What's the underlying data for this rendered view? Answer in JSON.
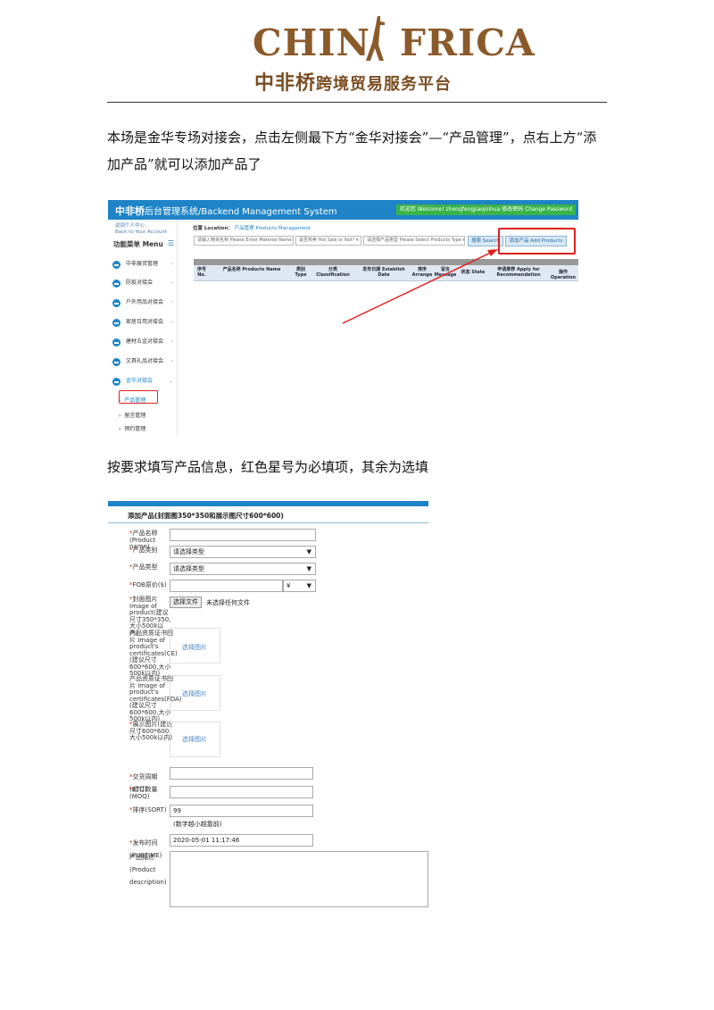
{
  "logo": {
    "main_text": "CHINAFRICA",
    "sub_brand": "中非桥",
    "sub_tagline": "跨境贸易服务平台"
  },
  "intro_paragraph": "本场是金华专场对接会，点击左侧最下方“金华对接会”—“产品管理”，点右上方“添加产品”就可以添加产品了",
  "fill_paragraph": "按要求填写产品信息，红色星号为必填项，其余为选填",
  "backend": {
    "system_title_cn": "中非桥",
    "system_title_rest": "后台管理系统/Backend Management System",
    "welcome": "欢迎您 Welcome! zhengfengjiaojinhua 修改密码 Change Password",
    "back_link_cn": "返回个人中心",
    "back_link_en": "Back to Your Account",
    "menu_title": "功能菜单 Menu",
    "menu_items": [
      "中非展贸管理",
      "防疫对接会",
      "户外用品对接会",
      "家居日用对接会",
      "建材五金对接会",
      "文具礼品对接会",
      "金华对接会"
    ],
    "sub_items": [
      "产品管理",
      "留言管理",
      "预约管理"
    ],
    "location_label": "位置 Location：",
    "location_path": "产品管理 Products Management",
    "material_placeholder": "请输入物资名称 Please Enter Material Name",
    "hot_sale_select": "是否热卖 Hot Sale or Not?",
    "product_type_select": "请选择产品类型 Please Select Products Type",
    "search_button": "搜索 Search",
    "add_products_button": "添加产品 Add Products",
    "table_headers": [
      "序号 No.",
      "产品名称 Products Name",
      "类别 Type",
      "分类 Classification",
      "发布日期 Establish Date",
      "排序 Arrange",
      "留言 Message",
      "状态 State",
      "申请推荐 Apply for Recommendation",
      "操作 Operation"
    ]
  },
  "form": {
    "title": "添加产品(封面图350*350和展示图尺寸600*600)",
    "labels": {
      "name": "产品名称(Product name)",
      "category": "产品类别",
      "type": "产品类型",
      "fob": "FOB原价($)",
      "cover": "封面图片Image of product(建议尺寸350*350,大小500k以内)",
      "cert_ce": "产品资质证书图片 Image of product's certificates(CE)(建议尺寸600*600,大小500k以内)",
      "cert_fda": "产品资质证书图片 Image of product's certificates(FDA)(建议尺寸600*600,大小500k以内)",
      "display": "展示图片(建议尺寸600*600,大小500k以内)",
      "etd": "交货周期(ETD)",
      "moq": "起订数量(MOQ)",
      "sort": "排序(SORT)",
      "pubtime": "发布时间(PUBTIME)",
      "description": "产品描述(Product description)"
    },
    "category_value": "请选择类型",
    "type_value": "请选择类型",
    "currency_value": "¥",
    "choose_file_button": "选择文件",
    "no_file_text": "未选择任何文件",
    "choose_image_button": "选择图片",
    "sort_value": "99",
    "sort_note": "(数字越小越靠前)",
    "pubtime_value": "2020-05-01 11:17:46"
  },
  "colors": {
    "brand_brown": "#8b5a2b",
    "backend_blue": "#1e84c6",
    "required_red": "#e02020",
    "welcome_green": "#3ab34a"
  }
}
